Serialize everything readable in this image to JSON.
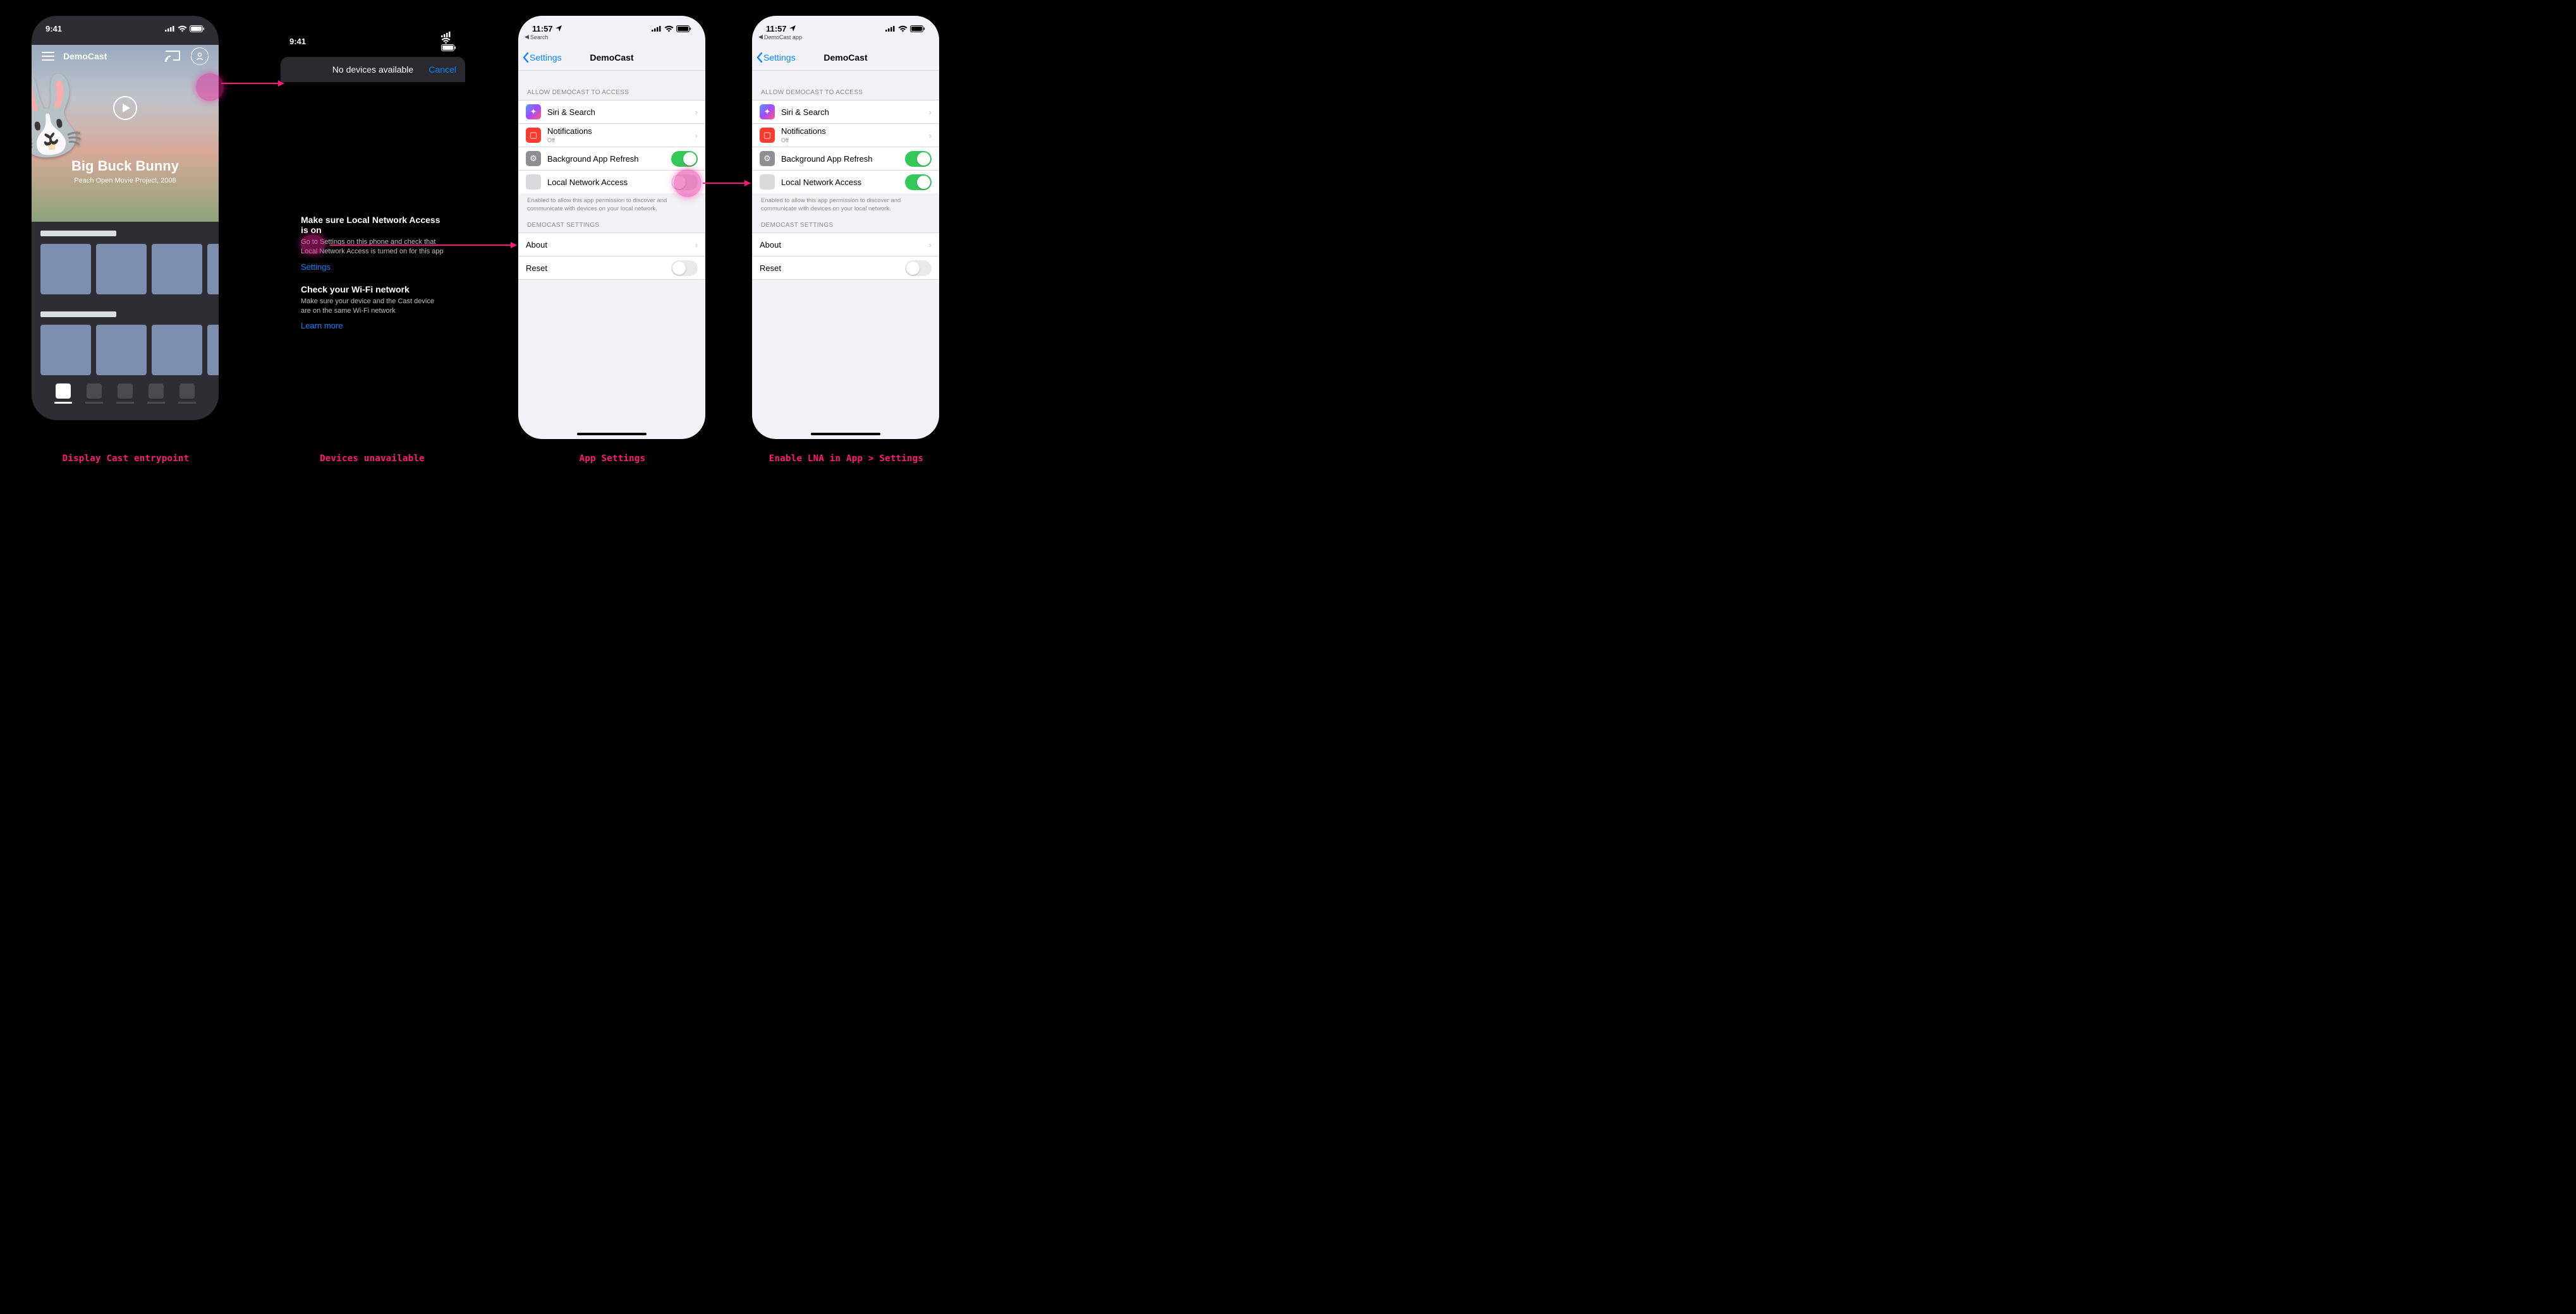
{
  "time_demo": "9:41",
  "time_live": "11:57",
  "captions": {
    "c1": "Display Cast entrypoint",
    "c2": "Devices unavailable",
    "c3": "App Settings",
    "c4": "Enable LNA in App > Settings"
  },
  "s1": {
    "app_title": "DemoCast",
    "hero_title": "Big Buck Bunny",
    "hero_sub": "Peach Open Movie Project, 2008"
  },
  "s2": {
    "sheet_title": "No devices available",
    "cancel": "Cancel",
    "h1": "Make sure Local Network Access is on",
    "p1": "Go to Settings on this phone and check that Local Network Access is turned on for this app",
    "settings_link": "Settings",
    "h2": "Check your Wi-Fi network",
    "p2": "Make sure your device and the Cast device are on the same Wi-Fi network",
    "learn_more": "Learn more"
  },
  "ios": {
    "back_search": "Search",
    "back_democast": "DemoCast app",
    "nav_back": "Settings",
    "nav_title": "DemoCast",
    "group_access": "Allow DemoCast to Access",
    "siri": "Siri & Search",
    "notif": "Notifications",
    "notif_sub": "Off",
    "bgrf": "Background App Refresh",
    "lna": "Local Network Access",
    "lna_footer": "Enabled to allow this app permission to discover and communicate with devices on your local network.",
    "group_app": "DemoCast Settings",
    "about": "About",
    "reset": "Reset"
  }
}
